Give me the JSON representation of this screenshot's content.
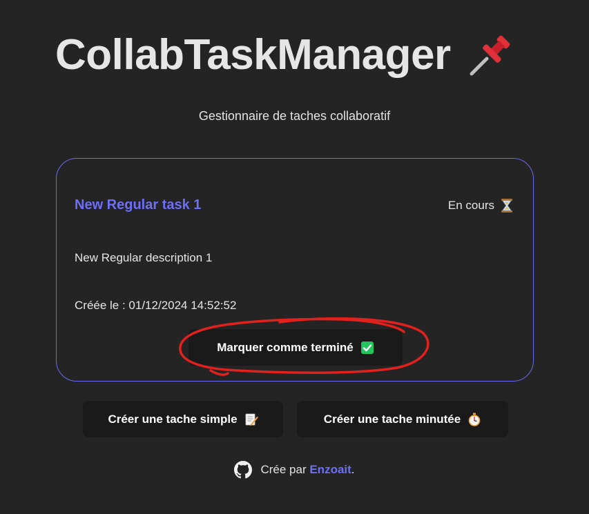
{
  "header": {
    "title": "CollabTaskManager",
    "title_icon": "pushpin-icon",
    "subtitle": "Gestionnaire de taches collaboratif"
  },
  "task": {
    "title": "New Regular task 1",
    "status": "En cours",
    "status_icon": "hourglass-icon",
    "description": "New Regular description 1",
    "created": "Créée le : 01/12/2024 14:52:52",
    "complete_button": "Marquer comme terminé",
    "complete_icon": "checkmark-box-icon"
  },
  "actions": {
    "create_simple": "Créer une tache simple",
    "create_simple_icon": "memo-icon",
    "create_timed": "Créer une tache minutée",
    "create_timed_icon": "stopwatch-icon"
  },
  "footer": {
    "prefix": "Crée par",
    "author": "Enzoait",
    "suffix": ".",
    "icon": "github-icon"
  },
  "colors": {
    "background": "#242424",
    "accent": "#6e6ef7",
    "button": "#1a1a1a",
    "annotation": "#e0211d"
  }
}
